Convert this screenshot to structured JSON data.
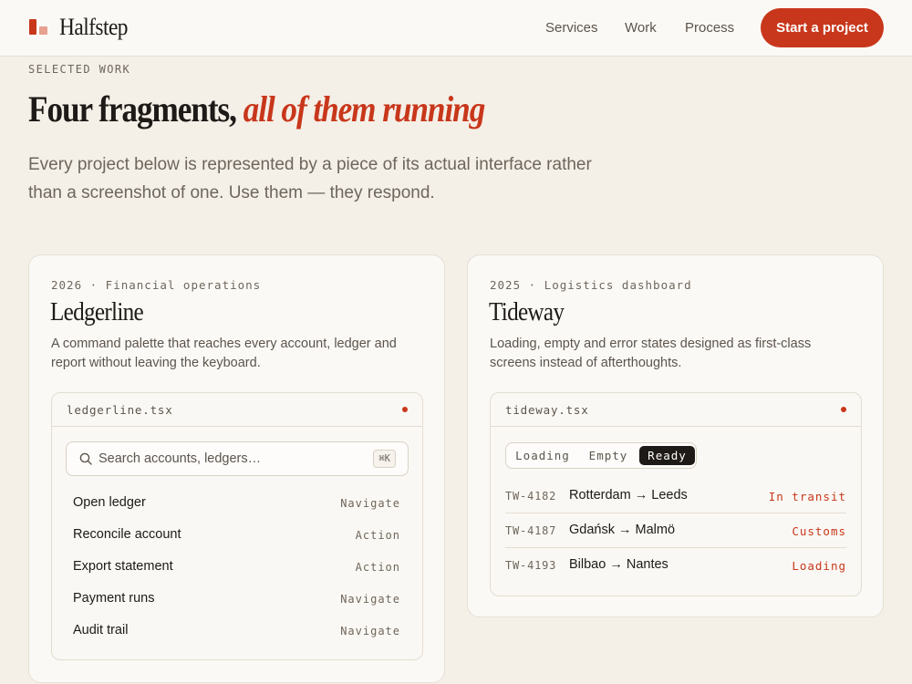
{
  "header": {
    "brand": "Halfstep",
    "nav": [
      "Services",
      "Work",
      "Process"
    ],
    "cta": "Start a project"
  },
  "hero": {
    "eyebrow": "SELECTED WORK",
    "title_plain": "Four fragments,",
    "title_accent": "all of them running",
    "intro": "Every project below is represented by a piece of its actual interface rather than a screenshot of one. Use them — they respond."
  },
  "projects": [
    {
      "meta": "2026 · Financial operations",
      "title": "Ledgerline",
      "description": "A command palette that reaches every account, ledger and report without leaving the keyboard.",
      "file": "ledgerline.tsx",
      "search_placeholder": "Search accounts, ledgers…",
      "shortcut": "⌘K",
      "commands": [
        {
          "label": "Open ledger",
          "type": "Navigate"
        },
        {
          "label": "Reconcile account",
          "type": "Action"
        },
        {
          "label": "Export statement",
          "type": "Action"
        },
        {
          "label": "Payment runs",
          "type": "Navigate"
        },
        {
          "label": "Audit trail",
          "type": "Navigate"
        }
      ]
    },
    {
      "meta": "2025 · Logistics dashboard",
      "title": "Tideway",
      "description": "Loading, empty and error states designed as first-class screens instead of afterthoughts.",
      "file": "tideway.tsx",
      "tabs": [
        "Loading",
        "Empty",
        "Ready"
      ],
      "active_tab": "Ready",
      "shipments": [
        {
          "id": "TW-4182",
          "route": "Rotterdam → Leeds",
          "status": "In transit"
        },
        {
          "id": "TW-4187",
          "route": "Gdańsk → Malmö",
          "status": "Customs"
        },
        {
          "id": "TW-4193",
          "route": "Bilbao → Nantes",
          "status": "Loading"
        }
      ]
    }
  ],
  "colors": {
    "accent": "#c8371b",
    "background": "#f4efe7",
    "card": "#fbf9f6",
    "text": "#1d1a17",
    "muted": "#6e665c"
  }
}
